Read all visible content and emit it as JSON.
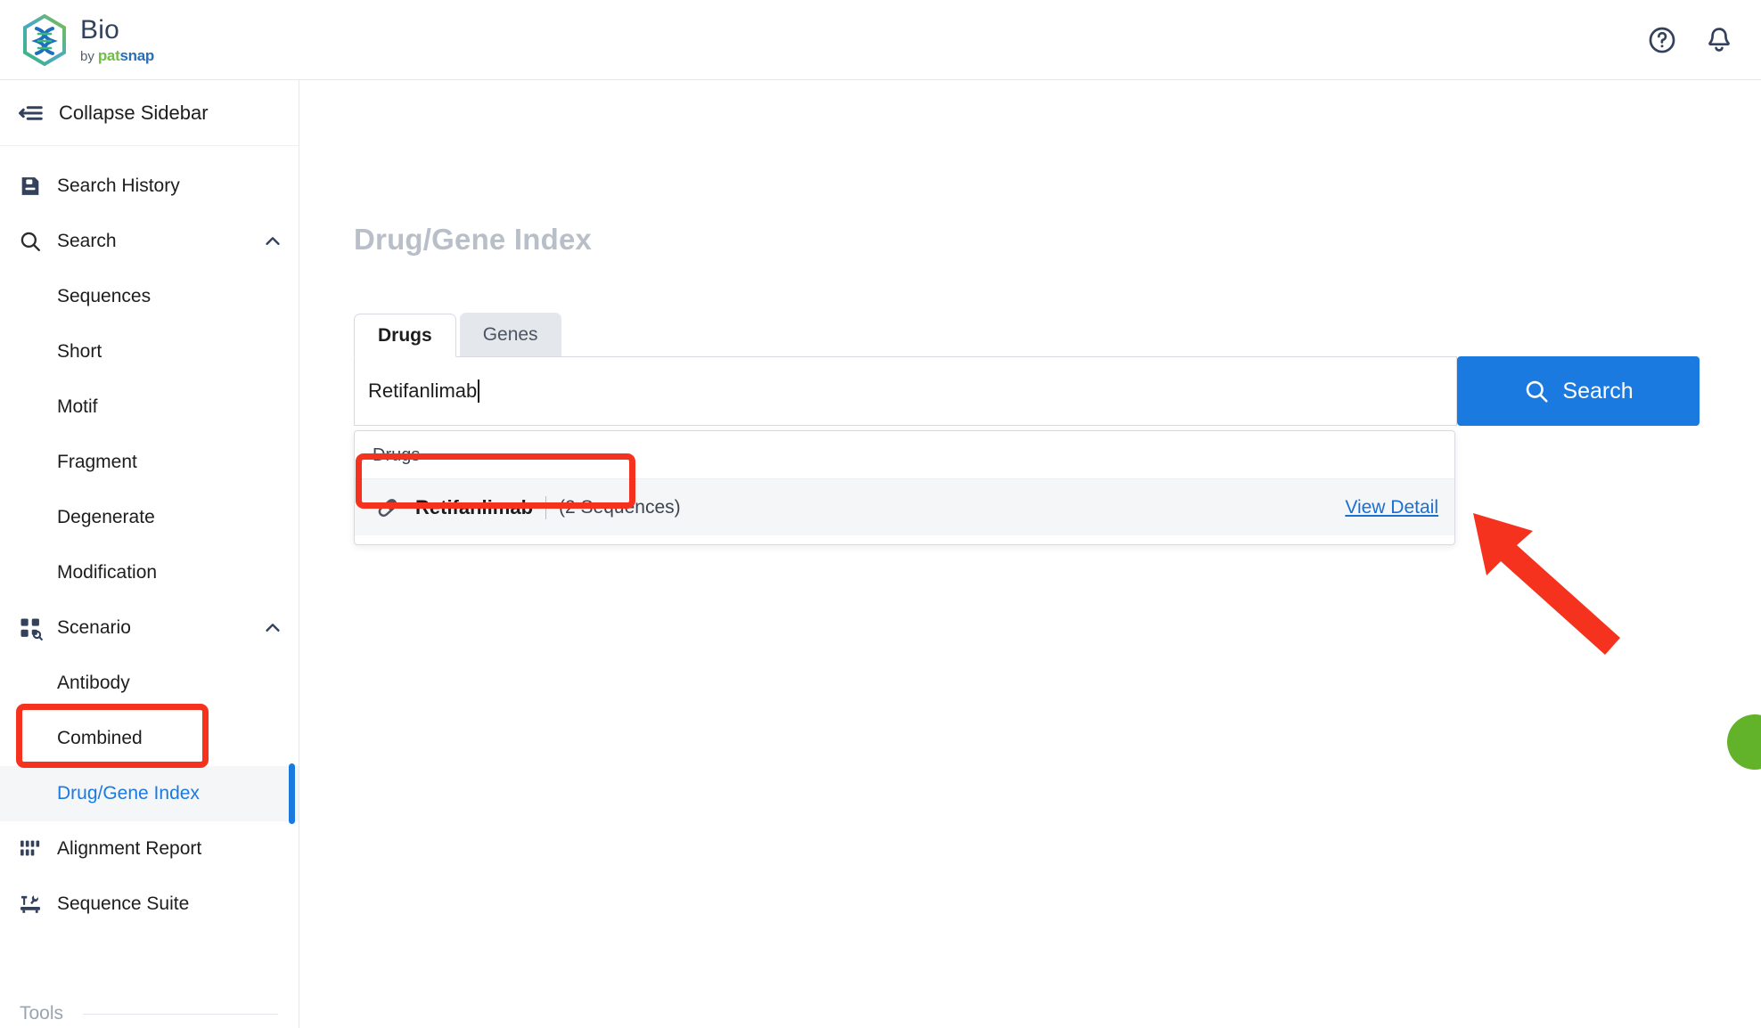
{
  "brand": {
    "logo_icon": "hexagon-dna-icon",
    "title": "Bio",
    "by": "by",
    "pat": "pat",
    "snap": "snap",
    "green": "#6fbe44",
    "blue": "#2c6fb5"
  },
  "topbar": {
    "help_icon": "help-circle-icon",
    "notifications_icon": "bell-icon"
  },
  "sidebar": {
    "collapse": {
      "label": "Collapse Sidebar",
      "icon": "collapse-sidebar-icon"
    },
    "items": [
      {
        "label": "Search History",
        "icon": "history-document-icon",
        "type": "item"
      },
      {
        "label": "Search",
        "icon": "search-icon",
        "type": "group",
        "expanded": true,
        "chevron": "chevron-up-icon"
      },
      {
        "label": "Sequences",
        "type": "sub"
      },
      {
        "label": "Short",
        "type": "sub"
      },
      {
        "label": "Motif",
        "type": "sub"
      },
      {
        "label": "Fragment",
        "type": "sub"
      },
      {
        "label": "Degenerate",
        "type": "sub"
      },
      {
        "label": "Modification",
        "type": "sub"
      },
      {
        "label": "Scenario",
        "icon": "scenario-grid-search-icon",
        "type": "group",
        "expanded": true,
        "chevron": "chevron-up-icon"
      },
      {
        "label": "Antibody",
        "type": "sub"
      },
      {
        "label": "Combined",
        "type": "sub"
      },
      {
        "label": "Drug/Gene Index",
        "type": "sub",
        "active": true
      },
      {
        "label": "Alignment Report",
        "icon": "alignment-bars-icon",
        "type": "item"
      },
      {
        "label": "Sequence Suite",
        "icon": "tools-suite-icon",
        "type": "item"
      }
    ],
    "tools_label": "Tools",
    "active_color": "#1a7ae0"
  },
  "main": {
    "page_title": "Drug/Gene Index",
    "tabs": [
      {
        "label": "Drugs",
        "active": true
      },
      {
        "label": "Genes",
        "active": false
      }
    ],
    "search": {
      "value": "Retifanlimab",
      "placeholder": "",
      "button_label": "Search",
      "button_icon": "search-icon",
      "button_color": "#1a7ae0"
    },
    "dropdown": {
      "header": "Drugs",
      "results": [
        {
          "icon": "pill-capsule-icon",
          "name": "Retifanlimab",
          "separator": "|",
          "count": "(2 Sequences)",
          "link": "View Detail"
        }
      ]
    }
  },
  "annotations": {
    "color": "#f5321e",
    "boxes": [
      {
        "name": "sidebar-drug-gene-index-highlight"
      },
      {
        "name": "dropdown-result-highlight"
      }
    ],
    "arrow": {
      "name": "view-detail-arrow",
      "points_to": "View Detail"
    }
  },
  "widgets": {
    "chat_fab": {
      "name": "chat-fab",
      "color": "#62b32a"
    }
  }
}
